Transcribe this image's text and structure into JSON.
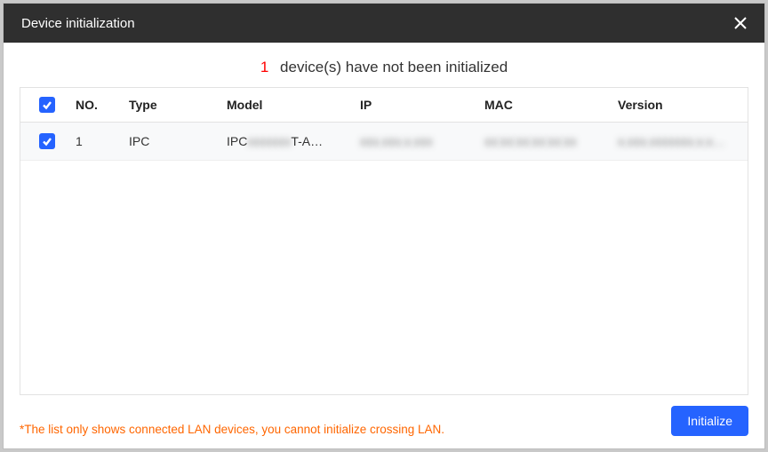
{
  "header": {
    "title": "Device initialization"
  },
  "notice": {
    "count": "1",
    "text": "device(s) have not been initialized"
  },
  "table": {
    "columns": {
      "no": "NO.",
      "type": "Type",
      "model": "Model",
      "ip": "IP",
      "mac": "MAC",
      "version": "Version"
    },
    "rows": [
      {
        "no": "1",
        "type": "IPC",
        "model_prefix": "IPC",
        "model_suffix": "T-A…",
        "model_redacted": "xxxxxxx",
        "ip": "xxx.xxx.x.xxx",
        "mac": "xx:xx:xx:xx:xx:xx",
        "version": "x.xxx.xxxxxxx.x.x…"
      }
    ]
  },
  "footer": {
    "note": "*The list only shows connected LAN devices, you cannot initialize crossing LAN.",
    "button": "Initialize"
  }
}
